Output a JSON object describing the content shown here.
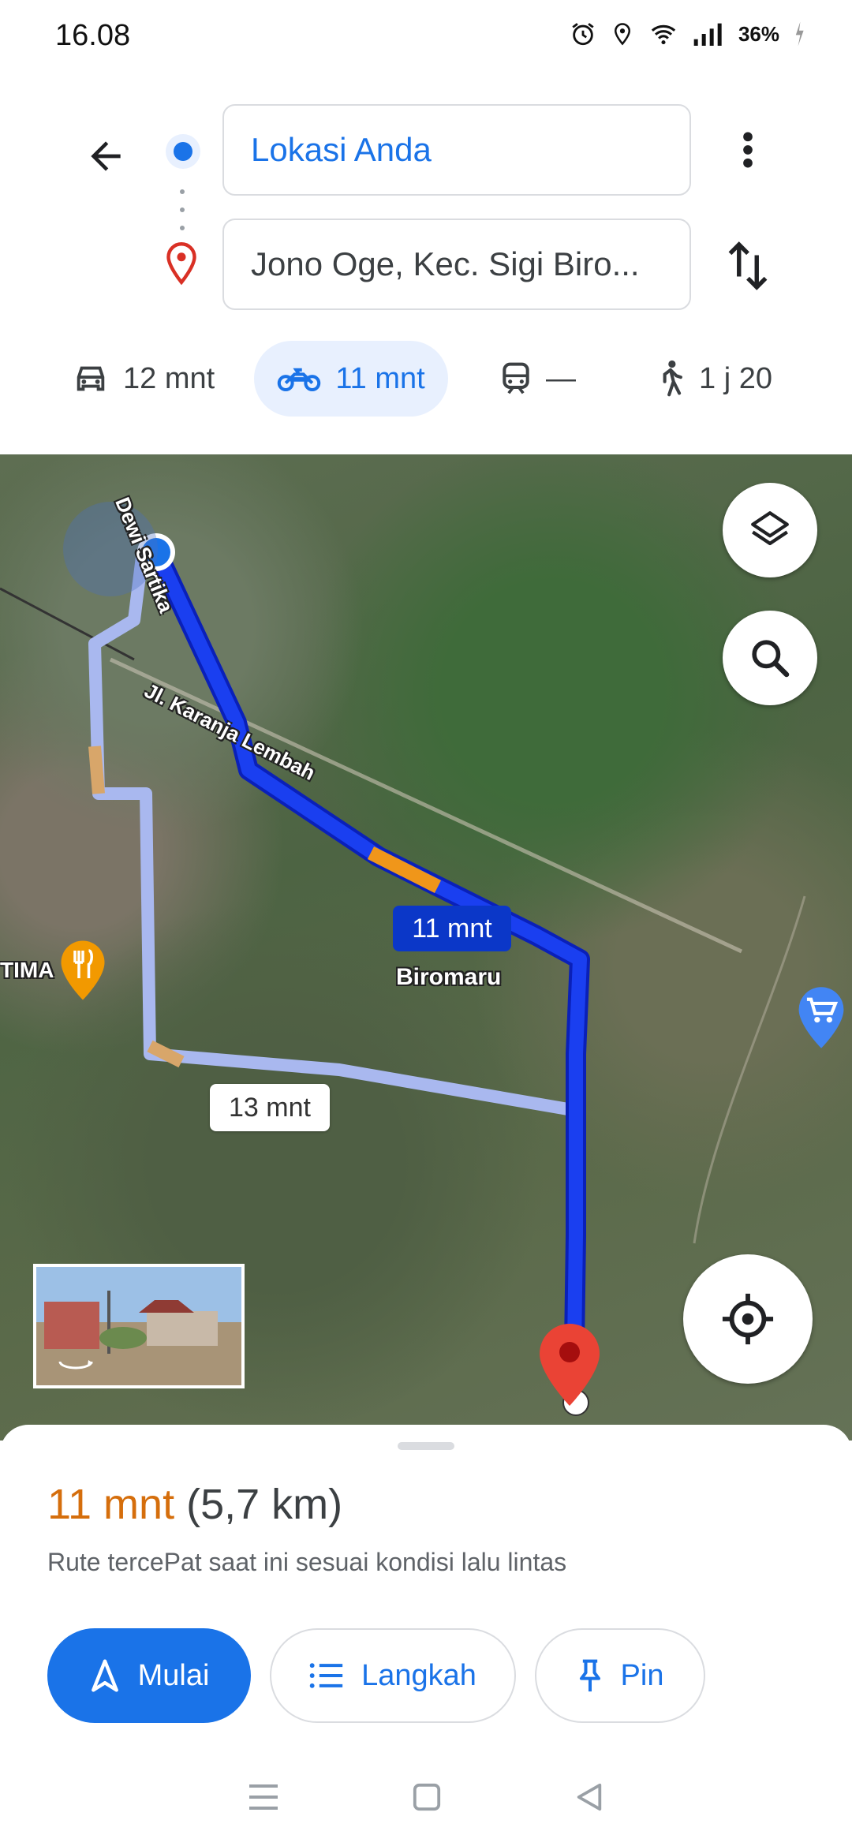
{
  "status": {
    "time": "16.08",
    "battery": "36%",
    "icons": [
      "alarm-icon",
      "location-icon",
      "wifi-icon",
      "signal-icon",
      "battery-icon"
    ]
  },
  "search": {
    "origin": "Lokasi Anda",
    "destination": "Jono Oge, Kec. Sigi Biro..."
  },
  "modes": [
    {
      "name": "car",
      "label": "12 mnt",
      "selected": false
    },
    {
      "name": "motorcycle",
      "label": "11 mnt",
      "selected": true
    },
    {
      "name": "transit",
      "label": "—",
      "selected": false
    },
    {
      "name": "walk",
      "label": "1 j 20",
      "selected": false
    }
  ],
  "map": {
    "street_1": "Dewi Sartika",
    "street_2": "Jl. Karanja Lembah",
    "place_label": "Biromaru",
    "poi_label": "TIMA",
    "primary_route_time": "11 mnt",
    "alt_route_time": "13 mnt"
  },
  "summary": {
    "time": "11 mnt",
    "distance": "(5,7 km)",
    "description": "Rute tercePat saat ini sesuai kondisi lalu lintas"
  },
  "actions": {
    "start": "Mulai",
    "steps": "Langkah",
    "pin": "Pin"
  },
  "colors": {
    "accent": "#1a73e8",
    "route_primary": "#1a3ff0",
    "route_alt": "#a9b8ef",
    "eta": "#d56e0c",
    "pin_red": "#ea4335"
  }
}
